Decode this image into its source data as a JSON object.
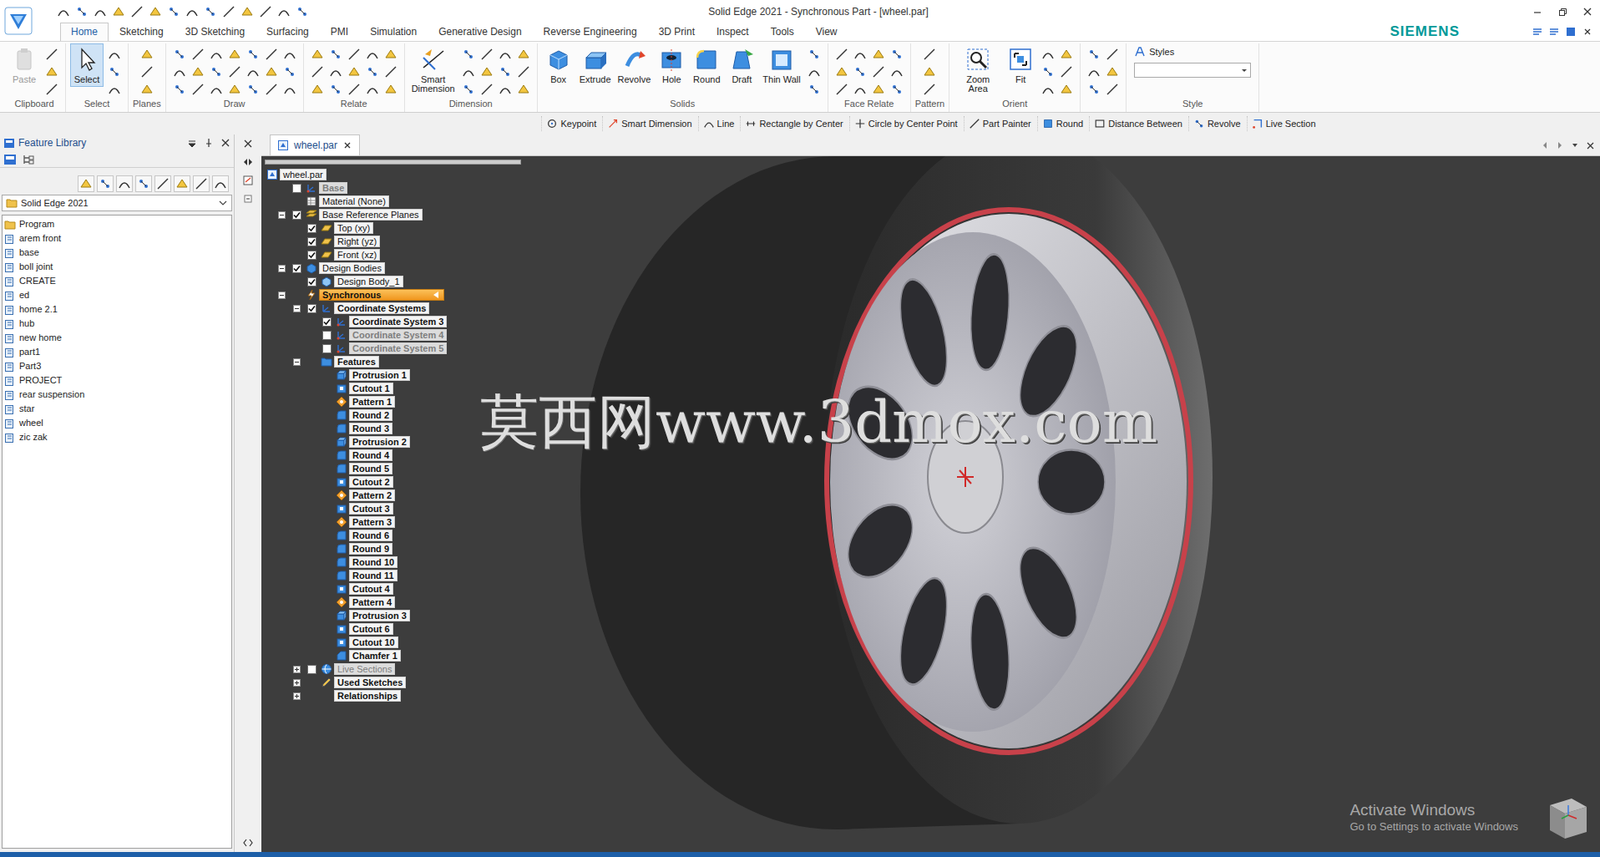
{
  "window": {
    "title": "Solid Edge 2021 - Synchronous Part - [wheel.par]"
  },
  "ribbon": {
    "tabs": [
      {
        "label": "Home",
        "selected": true
      },
      {
        "label": "Sketching",
        "selected": false
      },
      {
        "label": "3D Sketching",
        "selected": false
      },
      {
        "label": "Surfacing",
        "selected": false
      },
      {
        "label": "PMI",
        "selected": false
      },
      {
        "label": "Simulation",
        "selected": false
      },
      {
        "label": "Generative Design",
        "selected": false
      },
      {
        "label": "Reverse Engineering",
        "selected": false
      },
      {
        "label": "3D Print",
        "selected": false
      },
      {
        "label": "Inspect",
        "selected": false
      },
      {
        "label": "Tools",
        "selected": false
      },
      {
        "label": "View",
        "selected": false
      }
    ],
    "brand": "SIEMENS",
    "groups": [
      {
        "label": "Clipboard",
        "buttons": [
          {
            "label": "Paste",
            "selected": false,
            "disabled": true
          }
        ]
      },
      {
        "label": "Select",
        "buttons": [
          {
            "label": "Select",
            "selected": true,
            "disabled": false
          }
        ]
      },
      {
        "label": "Planes",
        "buttons": []
      },
      {
        "label": "Draw",
        "buttons": []
      },
      {
        "label": "Relate",
        "buttons": []
      },
      {
        "label": "Dimension",
        "buttons": [
          {
            "label": "Smart Dimension",
            "selected": false,
            "disabled": false
          }
        ]
      },
      {
        "label": "Solids",
        "buttons": [
          {
            "label": "Box",
            "selected": false,
            "disabled": false
          },
          {
            "label": "Extrude",
            "selected": false,
            "disabled": false
          },
          {
            "label": "Revolve",
            "selected": false,
            "disabled": false
          },
          {
            "label": "Hole",
            "selected": false,
            "disabled": false
          },
          {
            "label": "Round",
            "selected": false,
            "disabled": false
          },
          {
            "label": "Draft",
            "selected": false,
            "disabled": false
          },
          {
            "label": "Thin Wall",
            "selected": false,
            "disabled": false
          }
        ]
      },
      {
        "label": "Face Relate",
        "buttons": []
      },
      {
        "label": "Pattern",
        "buttons": []
      },
      {
        "label": "Orient",
        "buttons": [
          {
            "label": "Zoom Area",
            "selected": false,
            "disabled": false
          },
          {
            "label": "Fit",
            "selected": false,
            "disabled": false
          }
        ]
      },
      {
        "buttons": []
      },
      {
        "label": "Style",
        "buttons": [],
        "styles": {
          "label": "Styles"
        }
      }
    ]
  },
  "command_bar": [
    "Keypoint",
    "Smart Dimension",
    "Line",
    "Rectangle by Center",
    "Circle by Center Point",
    "Part Painter",
    "Round",
    "Distance Between",
    "Revolve",
    "Live Section"
  ],
  "feature_library": {
    "title": "Feature Library",
    "library": "Solid Edge 2021",
    "items": [
      {
        "label": "Program",
        "kind": "root"
      },
      {
        "label": "arem front",
        "kind": "folder"
      },
      {
        "label": "base",
        "kind": "folder"
      },
      {
        "label": "boll joint",
        "kind": "folder"
      },
      {
        "label": "CREATE",
        "kind": "folder"
      },
      {
        "label": "ed",
        "kind": "folder"
      },
      {
        "label": "home 2.1",
        "kind": "folder"
      },
      {
        "label": "hub",
        "kind": "folder"
      },
      {
        "label": "new home",
        "kind": "folder"
      },
      {
        "label": "part1",
        "kind": "folder"
      },
      {
        "label": "Part3",
        "kind": "folder"
      },
      {
        "label": "PROJECT",
        "kind": "folder"
      },
      {
        "label": "rear suspension",
        "kind": "folder"
      },
      {
        "label": "star",
        "kind": "folder"
      },
      {
        "label": "wheel",
        "kind": "folder"
      },
      {
        "label": "zic zak",
        "kind": "folder"
      }
    ]
  },
  "document": {
    "tab": {
      "label": "wheel.par",
      "selected": true
    },
    "tree": [
      {
        "label": "wheel.par",
        "depth": 0,
        "kind": "part",
        "dimmed": false,
        "selected": false
      },
      {
        "label": "Base",
        "depth": 1,
        "kind": "coord",
        "checked": false,
        "dimmed": true,
        "selected": false
      },
      {
        "label": "Material (None)",
        "depth": 1,
        "kind": "material",
        "dimmed": false,
        "selected": false
      },
      {
        "label": "Base Reference Planes",
        "depth": 1,
        "kind": "planes",
        "expanded": true,
        "checked": true,
        "dimmed": false,
        "selected": false
      },
      {
        "label": "Top (xy)",
        "depth": 2,
        "kind": "plane",
        "checked": true,
        "dimmed": false,
        "selected": false
      },
      {
        "label": "Right (yz)",
        "depth": 2,
        "kind": "plane",
        "checked": true,
        "dimmed": false,
        "selected": false
      },
      {
        "label": "Front (xz)",
        "depth": 2,
        "kind": "plane",
        "checked": true,
        "dimmed": false,
        "selected": false
      },
      {
        "label": "Design Bodies",
        "depth": 1,
        "kind": "bodies",
        "expanded": true,
        "checked": true,
        "dimmed": false,
        "selected": false
      },
      {
        "label": "Design Body_1",
        "depth": 2,
        "kind": "body",
        "checked": true,
        "dimmed": false,
        "selected": false
      },
      {
        "label": "Synchronous",
        "depth": 1,
        "kind": "synchronous",
        "expanded": true,
        "dimmed": false,
        "selected": true
      },
      {
        "label": "Coordinate Systems",
        "depth": 2,
        "kind": "coords",
        "expanded": true,
        "checked": true,
        "dimmed": false,
        "selected": false
      },
      {
        "label": "Coordinate System 3",
        "depth": 3,
        "kind": "coord",
        "checked": true,
        "dimmed": false,
        "selected": false
      },
      {
        "label": "Coordinate System 4",
        "depth": 3,
        "kind": "coord",
        "checked": false,
        "dimmed": true,
        "selected": false
      },
      {
        "label": "Coordinate System 5",
        "depth": 3,
        "kind": "coord",
        "checked": false,
        "dimmed": true,
        "selected": false
      },
      {
        "label": "Features",
        "depth": 2,
        "kind": "features",
        "expanded": true,
        "dimmed": false,
        "selected": false
      },
      {
        "label": "Protrusion 1",
        "depth": 3,
        "kind": "protrusion",
        "dimmed": false,
        "selected": false
      },
      {
        "label": "Cutout 1",
        "depth": 3,
        "kind": "cutout",
        "dimmed": false,
        "selected": false
      },
      {
        "label": "Pattern 1",
        "depth": 3,
        "kind": "pattern",
        "dimmed": false,
        "selected": false
      },
      {
        "label": "Round 2",
        "depth": 3,
        "kind": "round",
        "dimmed": false,
        "selected": false
      },
      {
        "label": "Round 3",
        "depth": 3,
        "kind": "round",
        "dimmed": false,
        "selected": false
      },
      {
        "label": "Protrusion 2",
        "depth": 3,
        "kind": "protrusion",
        "dimmed": false,
        "selected": false
      },
      {
        "label": "Round 4",
        "depth": 3,
        "kind": "round",
        "dimmed": false,
        "selected": false
      },
      {
        "label": "Round 5",
        "depth": 3,
        "kind": "round",
        "dimmed": false,
        "selected": false
      },
      {
        "label": "Cutout 2",
        "depth": 3,
        "kind": "cutout",
        "dimmed": false,
        "selected": false
      },
      {
        "label": "Pattern 2",
        "depth": 3,
        "kind": "pattern",
        "dimmed": false,
        "selected": false
      },
      {
        "label": "Cutout 3",
        "depth": 3,
        "kind": "cutout",
        "dimmed": false,
        "selected": false
      },
      {
        "label": "Pattern 3",
        "depth": 3,
        "kind": "pattern",
        "dimmed": false,
        "selected": false
      },
      {
        "label": "Round 6",
        "depth": 3,
        "kind": "round",
        "dimmed": false,
        "selected": false
      },
      {
        "label": "Round 9",
        "depth": 3,
        "kind": "round",
        "dimmed": false,
        "selected": false
      },
      {
        "label": "Round 10",
        "depth": 3,
        "kind": "round",
        "dimmed": false,
        "selected": false
      },
      {
        "label": "Round 11",
        "depth": 3,
        "kind": "round",
        "dimmed": false,
        "selected": false
      },
      {
        "label": "Cutout 4",
        "depth": 3,
        "kind": "cutout",
        "dimmed": false,
        "selected": false
      },
      {
        "label": "Pattern 4",
        "depth": 3,
        "kind": "pattern",
        "dimmed": false,
        "selected": false
      },
      {
        "label": "Protrusion 3",
        "depth": 3,
        "kind": "protrusion",
        "dimmed": false,
        "selected": false
      },
      {
        "label": "Cutout 6",
        "depth": 3,
        "kind": "cutout",
        "dimmed": false,
        "selected": false
      },
      {
        "label": "Cutout 10",
        "depth": 3,
        "kind": "cutout",
        "dimmed": false,
        "selected": false
      },
      {
        "label": "Chamfer 1",
        "depth": 3,
        "kind": "chamfer",
        "dimmed": false,
        "selected": false
      },
      {
        "label": "Live Sections",
        "depth": 2,
        "kind": "sections",
        "expanded": false,
        "checked": false,
        "dimmed": true,
        "selected": false
      },
      {
        "label": "Used Sketches",
        "depth": 2,
        "kind": "sketches",
        "expanded": false,
        "dimmed": false,
        "selected": false
      },
      {
        "label": "Relationships",
        "depth": 2,
        "kind": "plain",
        "expanded": false,
        "dimmed": false,
        "selected": false
      }
    ],
    "watermark": "莫西网www.3dmox.com"
  },
  "activation": {
    "title": "Activate Windows",
    "subtitle": "Go to Settings to activate Windows"
  }
}
